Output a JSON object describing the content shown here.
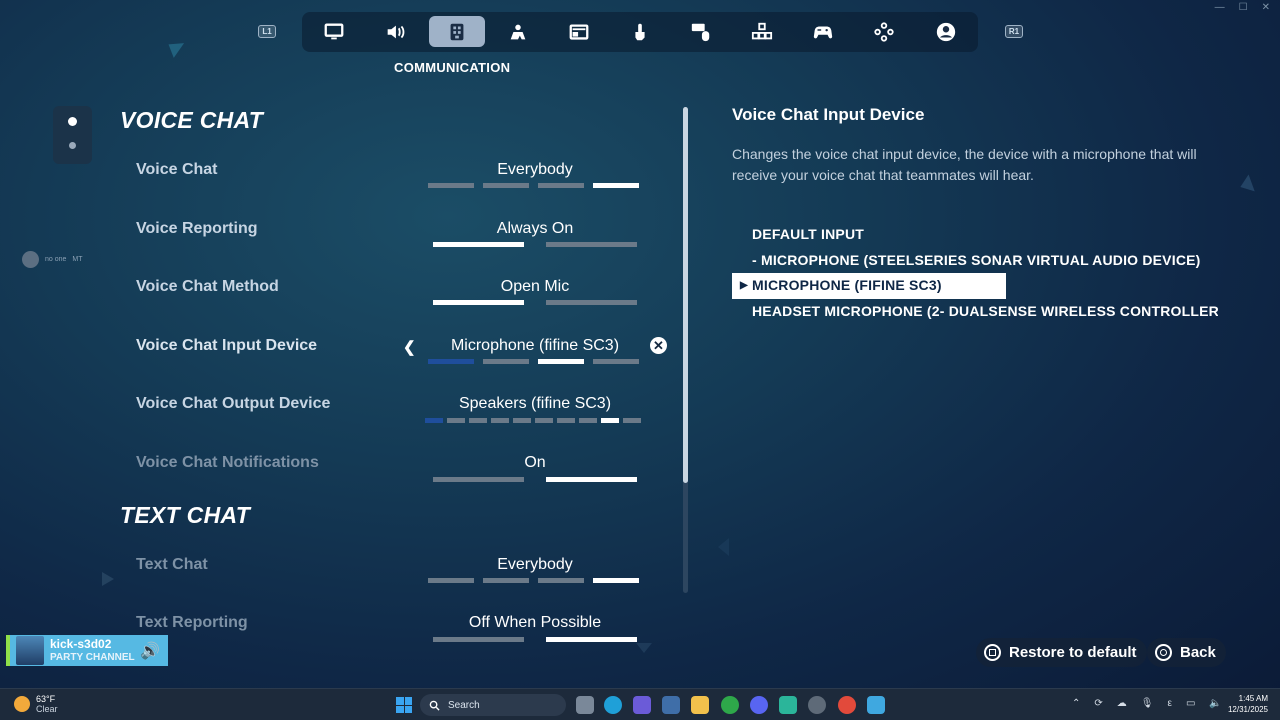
{
  "window_controls": [
    "—",
    "☐",
    "✕"
  ],
  "nav": {
    "left_bumper": "L1",
    "right_bumper": "R1",
    "tabs": [
      {
        "icon": "monitor-icon",
        "name": "display"
      },
      {
        "icon": "speaker-icon",
        "name": "audio"
      },
      {
        "icon": "communication-icon",
        "name": "communication",
        "active": true
      },
      {
        "icon": "game-icon",
        "name": "game"
      },
      {
        "icon": "hud-icon",
        "name": "hud"
      },
      {
        "icon": "touch-icon",
        "name": "touch"
      },
      {
        "icon": "keyboard-mouse-icon",
        "name": "keyboard-mouse"
      },
      {
        "icon": "controller-layout-icon",
        "name": "controller-layout"
      },
      {
        "icon": "controller-icon",
        "name": "controller"
      },
      {
        "icon": "gamepad-icon",
        "name": "gamepad"
      },
      {
        "icon": "account-icon",
        "name": "account"
      }
    ],
    "active_label": "COMMUNICATION"
  },
  "voice_chat": {
    "title": "VOICE CHAT",
    "rows": [
      {
        "label": "Voice Chat",
        "value": "Everybody",
        "segments": 4,
        "selected": 4
      },
      {
        "label": "Voice Reporting",
        "value": "Always On",
        "segments": 2,
        "selected": 1
      },
      {
        "label": "Voice Chat Method",
        "value": "Open Mic",
        "segments": 2,
        "selected": 1
      },
      {
        "label": "Voice Chat Input Device",
        "value": "Microphone (fifine SC3)",
        "segments": 4,
        "selected": 2
      },
      {
        "label": "Voice Chat Output Device",
        "value": "Speakers (fifine SC3)",
        "segments": 10,
        "selected": 9
      },
      {
        "label": "Voice Chat Notifications",
        "value": "On",
        "segments": 2,
        "selected": 2
      }
    ]
  },
  "text_chat": {
    "title": "TEXT CHAT",
    "rows": [
      {
        "label": "Text Chat",
        "value": "Everybody",
        "segments": 4,
        "selected": 4
      },
      {
        "label": "Text Reporting",
        "value": "Off When Possible",
        "segments": 2,
        "selected": 2
      }
    ]
  },
  "help": {
    "title": "Voice Chat Input Device",
    "description": "Changes the voice chat input device, the device with a microphone that will receive your voice chat that teammates will hear.",
    "options": [
      "DEFAULT INPUT",
      "- MICROPHONE (STEELSERIES SONAR VIRTUAL AUDIO DEVICE)",
      "MICROPHONE (FIFINE SC3)",
      "HEADSET MICROPHONE (2- DUALSENSE WIRELESS CONTROLLER)"
    ],
    "selected_index": 2
  },
  "hints": {
    "restore": "Restore to default",
    "back": "Back"
  },
  "party": {
    "name": "kick-s3d02",
    "channel": "PARTY CHANNEL"
  },
  "mini_status": {
    "text": "no one",
    "badge": "MT"
  },
  "taskbar": {
    "temp": "63°F",
    "condition": "Clear",
    "search": "Search",
    "time": "1:45 AM",
    "date": "12/31/2025"
  },
  "colors": {
    "accent_blue": "#1f4e9c",
    "selected_white": "#ffffff",
    "segment_off": "#6b7a89",
    "party_blue": "#56b9e3"
  }
}
